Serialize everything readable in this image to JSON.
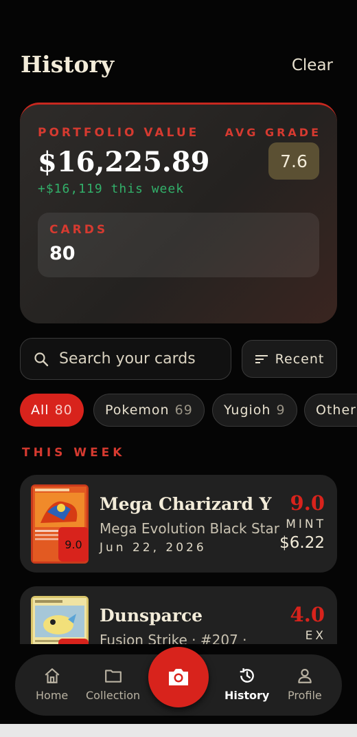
{
  "header": {
    "title": "History",
    "clear_label": "Clear"
  },
  "portfolio": {
    "value_label": "PORTFOLIO VALUE",
    "value": "$16,225.89",
    "change": "+$16,119 this week",
    "avg_grade_label": "AVG GRADE",
    "avg_grade": "7.6",
    "cards_label": "CARDS",
    "cards_count": "80"
  },
  "search": {
    "placeholder": "Search your cards",
    "sort_label": "Recent"
  },
  "filters": [
    {
      "label": "All",
      "count": "80",
      "active": true
    },
    {
      "label": "Pokemon",
      "count": "69",
      "active": false
    },
    {
      "label": "Yugioh",
      "count": "9",
      "active": false
    },
    {
      "label": "Other",
      "count": "",
      "active": false
    }
  ],
  "section_label": "THIS WEEK",
  "items": [
    {
      "name": "Mega Charizard Y",
      "set": "Mega Evolution Black Star",
      "date": "Jun 22, 2026",
      "grade": "9.0",
      "condition": "MINT",
      "price": "$6.22",
      "thumb_grade": "9.0"
    },
    {
      "name": "Dunsparce",
      "set": "Fusion Strike · #207 ·",
      "date": "",
      "grade": "4.0",
      "condition": "EX",
      "price": "",
      "thumb_grade": ""
    }
  ],
  "nav": {
    "home": "Home",
    "collection": "Collection",
    "history": "History",
    "profile": "Profile"
  },
  "colors": {
    "accent": "#d8231c",
    "positive": "#32b06a",
    "background": "#050505"
  }
}
